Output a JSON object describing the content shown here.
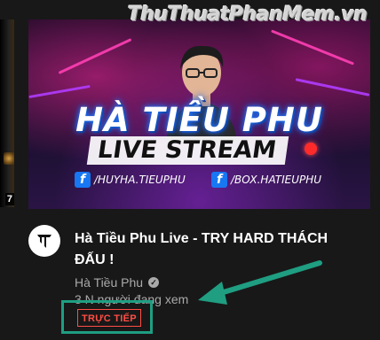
{
  "watermark": "ThuThuatPhanMem.vn",
  "previous_video": {
    "duration_partial": "7"
  },
  "thumbnail": {
    "title_text": "HÀ TIỀU PHU",
    "subtitle_text": "LIVE STREAM",
    "socials": [
      {
        "label": "/HUYHA.TIEUPHU"
      },
      {
        "label": "/BOX.HATIEUPHU"
      }
    ]
  },
  "video": {
    "title": "Hà Tiều Phu Live - TRY HARD THÁCH ĐẤU !",
    "channel": "Hà Tiều Phu",
    "viewers": "3 N người đang xem",
    "live_badge": "TRỰC TIẾP"
  },
  "colors": {
    "background": "#181818",
    "live_red": "#ff4e45",
    "annotation_green": "#1f9e82"
  }
}
